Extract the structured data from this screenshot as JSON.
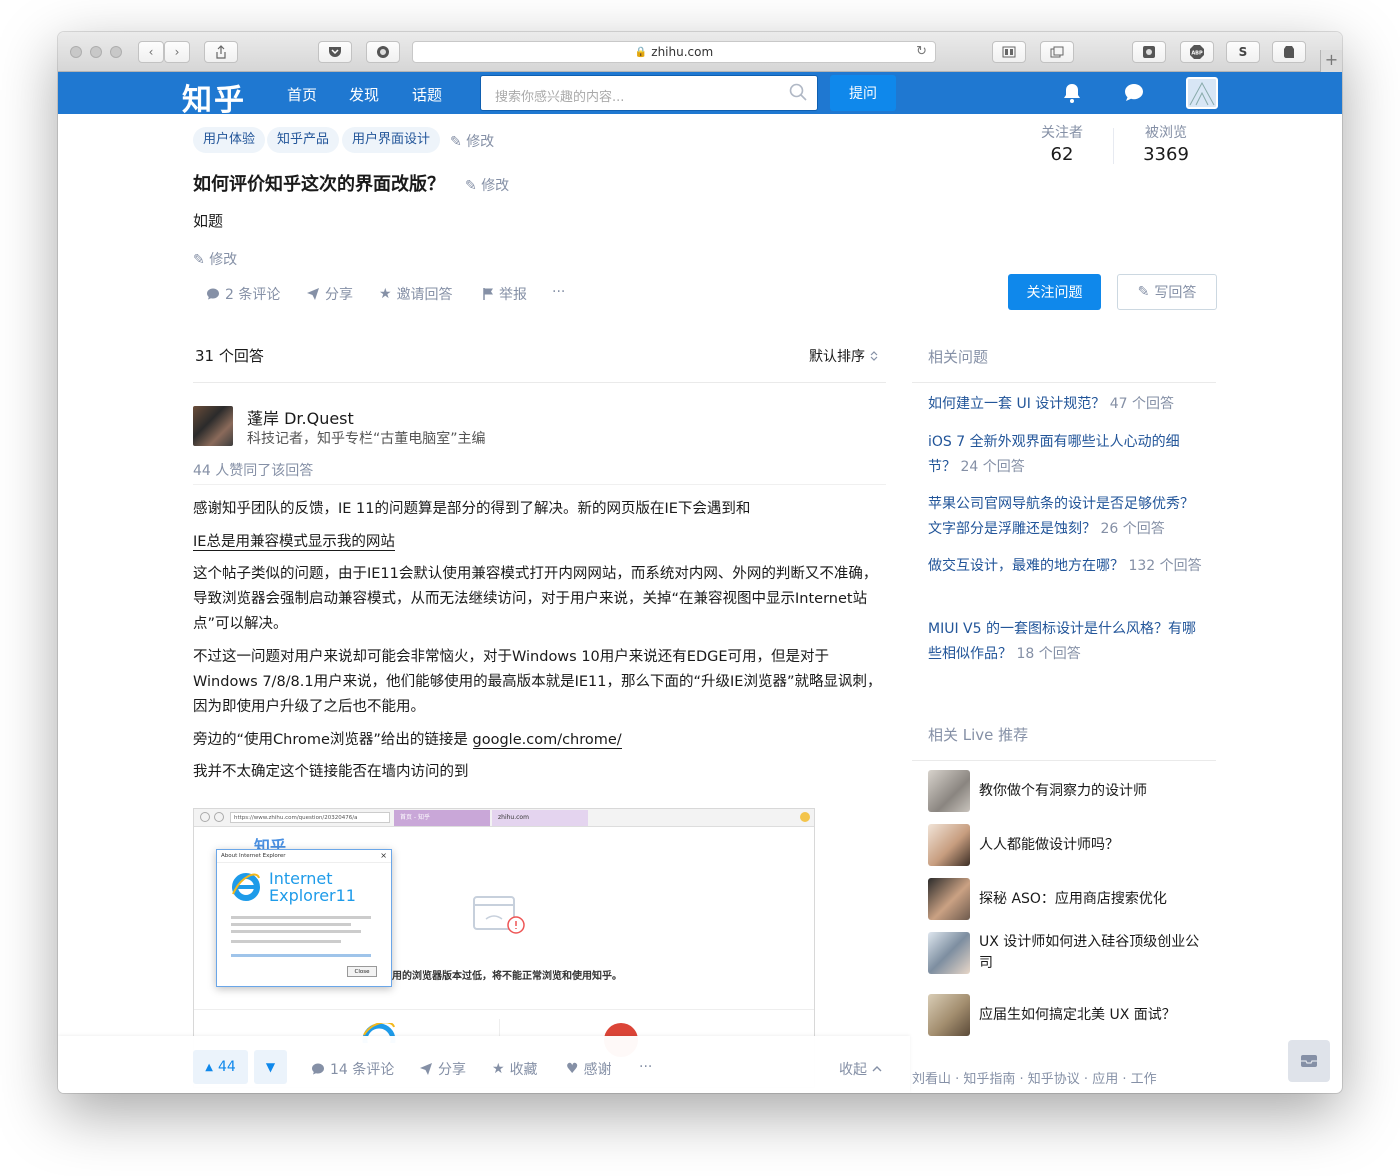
{
  "browser": {
    "url": "zhihu.com"
  },
  "nav": {
    "logo": "知乎",
    "links": [
      "首页",
      "发现",
      "话题"
    ],
    "search_placeholder": "搜索你感兴趣的内容...",
    "ask_label": "提问"
  },
  "question": {
    "tags": [
      "用户体验",
      "知乎产品",
      "用户界面设计"
    ],
    "tag_edit": "修改",
    "title": "如何评价知乎这次的界面改版？",
    "title_edit": "修改",
    "detail": "如题",
    "detail_edit": "修改",
    "actions": {
      "comments": "2 条评论",
      "share": "分享",
      "invite": "邀请回答",
      "report": "举报",
      "more": "···"
    },
    "stats": {
      "followers_label": "关注者",
      "followers": "62",
      "views_label": "被浏览",
      "views": "3369"
    },
    "follow_label": "关注问题",
    "write_label": "写回答"
  },
  "answers": {
    "count_label": "31 个回答",
    "sort_label": "默认排序"
  },
  "answer": {
    "author_name": "蓬岸 Dr.Quest",
    "author_bio": "科技记者，知乎专栏“古董电脑室”主编",
    "votes_text": "44 人赞同了该回答",
    "paragraphs": [
      "感谢知乎团队的反馈，IE 11的问题算是部分的得到了解决。新的网页版在IE下会遇到和",
      "IE总是用兼容模式显示我的网站",
      "这个帖子类似的问题，由于IE11会默认使用兼容模式打开内网网站，而系统对内网、外网的判断又不准确，导致浏览器会强制启动兼容模式，从而无法继续访问，对于用户来说，关掉“在兼容视图中显示Internet站点”可以解决。",
      "不过这一问题对用户来说却可能会非常恼火，对于Windows 10用户来说还有EDGE可用，但是对于Windows 7/8/8.1用户来说，他们能够使用的最高版本就是IE11，那么下面的“升级IE浏览器”就略显讽刺，因为即使用户升级了之后也不能用。",
      "旁边的“使用Chrome浏览器”给出的链接是 ",
      "google.com/chrome/",
      "我并不太确定这个链接能否在墙内访问的到"
    ],
    "embedded": {
      "logo": "知乎",
      "dialog_title": "About Internet Explorer",
      "ie_name_1": "Internet",
      "ie_name_2": "Explorer11",
      "warning_text": "用的浏览器版本过低，将不能正常浏览和使用知乎。",
      "close_label": "Close",
      "tab_1": "首页 - 知乎",
      "tab_2": "zhihu.com",
      "address": "https://www.zhihu.com/question/20320476/a"
    }
  },
  "bottom_bar": {
    "vote_count": "44",
    "comments": "14 条评论",
    "share": "分享",
    "collect": "收藏",
    "thanks": "感谢",
    "more": "···",
    "collapse": "收起"
  },
  "sidebar": {
    "related_title": "相关问题",
    "related": [
      {
        "title": "如何建立一套 UI 设计规范？",
        "count": "47 个回答"
      },
      {
        "title": "iOS 7 全新外观界面有哪些让人心动的细节？",
        "count": "24 个回答"
      },
      {
        "title": "苹果公司官网导航条的设计是否足够优秀？文字部分是浮雕还是蚀刻？",
        "count": "26 个回答"
      },
      {
        "title": "做交互设计，最难的地方在哪？",
        "count": "132 个回答"
      },
      {
        "title": "MIUI V5 的一套图标设计是什么风格？有哪些相似作品？",
        "count": "18 个回答"
      }
    ],
    "live_title": "相关 Live 推荐",
    "live": [
      "教你做个有洞察力的设计师",
      "人人都能做设计师吗？",
      "探秘 ASO：应用商店搜索优化",
      "UX 设计师如何进入硅谷顶级创业公司",
      "应届生如何搞定北美 UX 面试？"
    ],
    "footer": "刘看山 · 知乎指南 · 知乎协议 · 应用 · 工作"
  },
  "colors": {
    "brand_blue": "#1f78d1",
    "button_blue": "#0f88eb",
    "link_blue": "#225599",
    "muted": "#8590a6"
  }
}
